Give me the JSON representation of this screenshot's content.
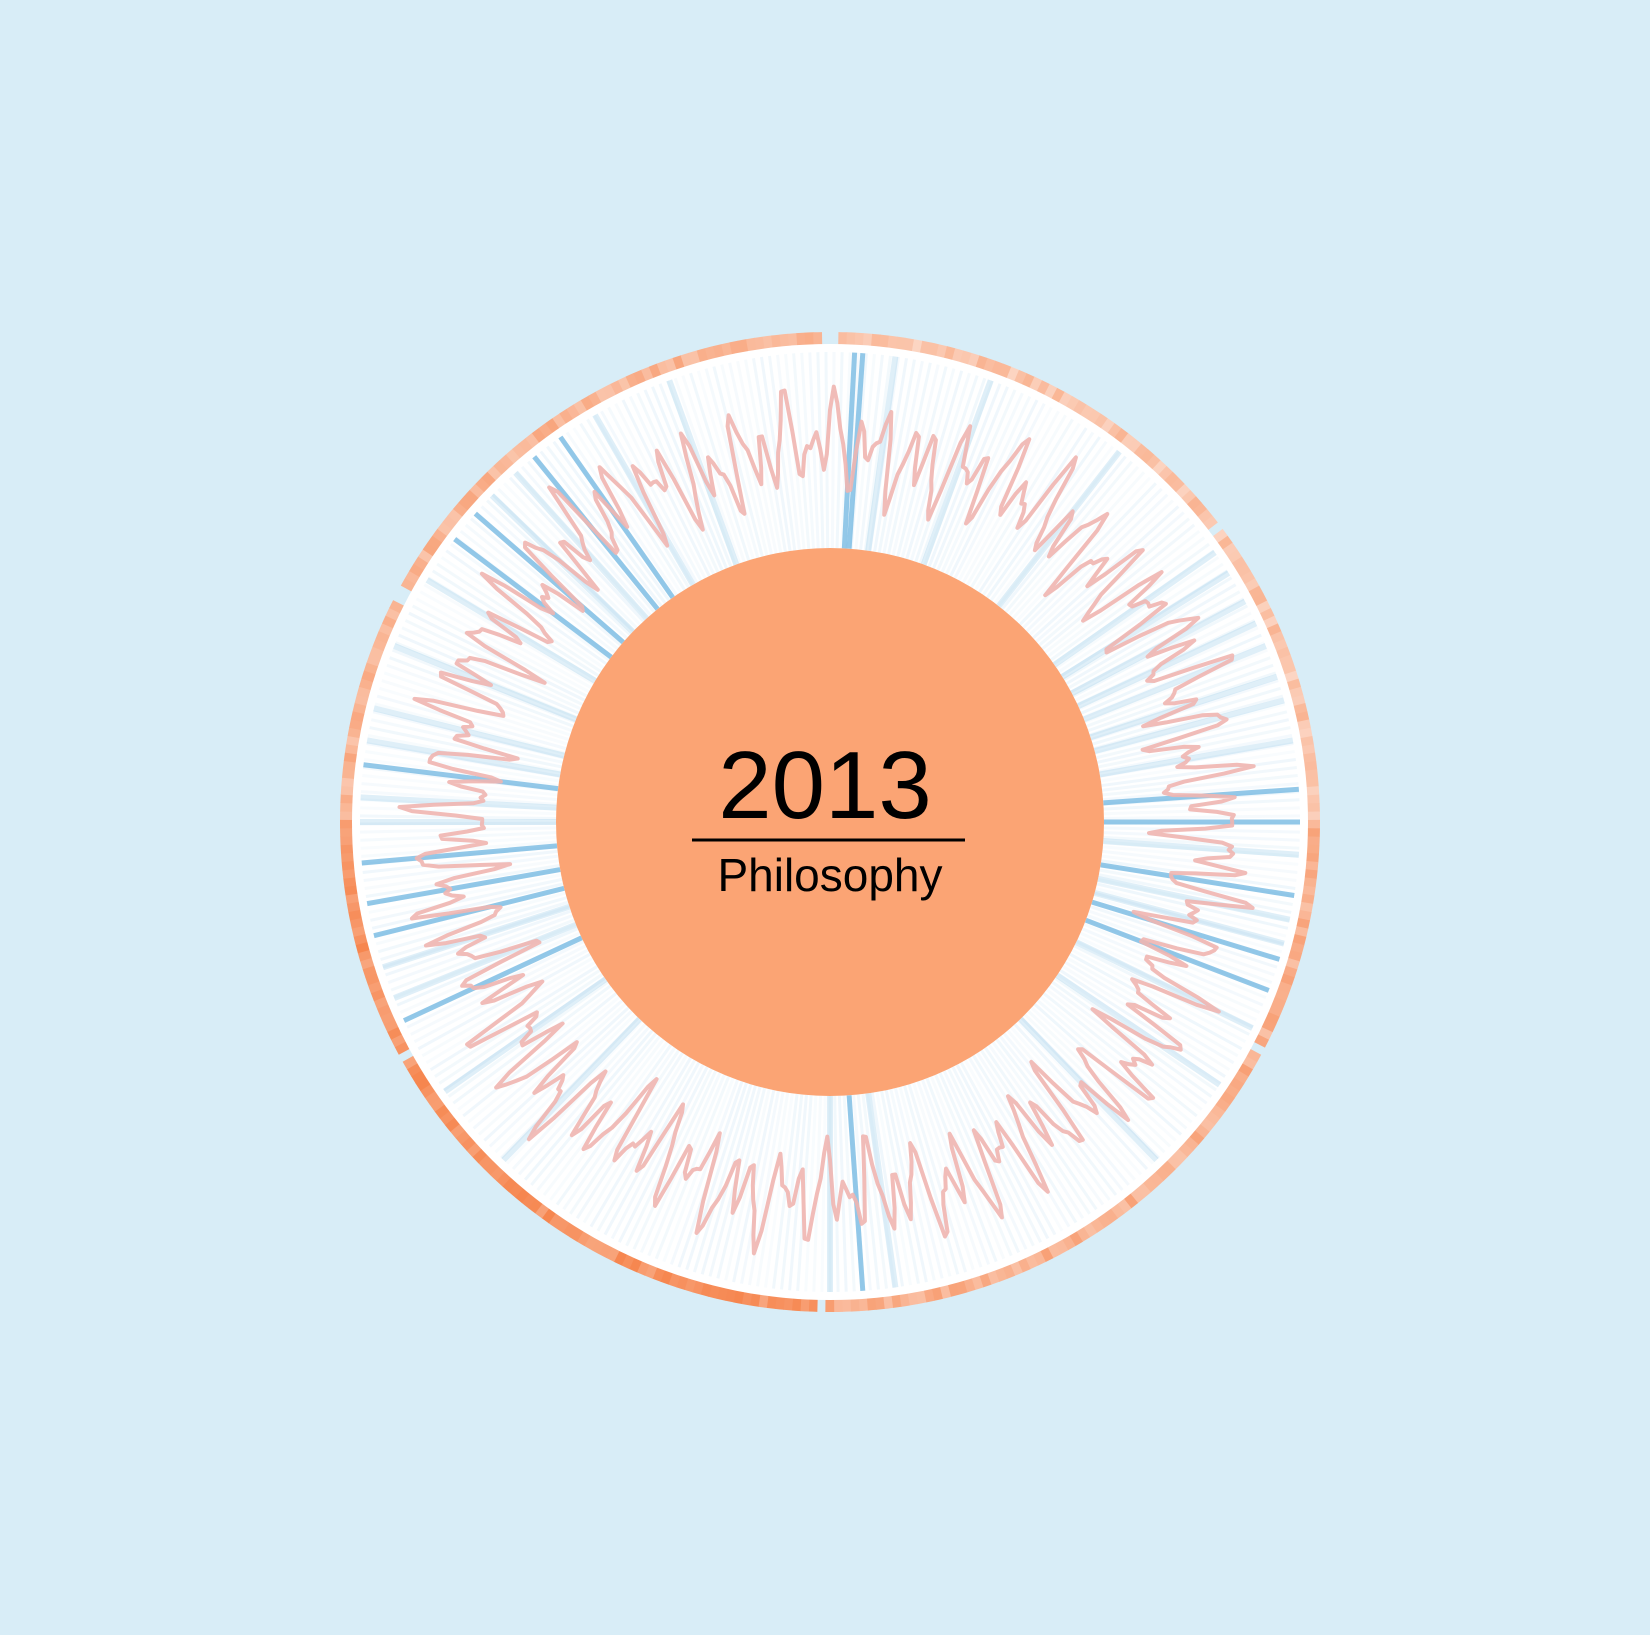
{
  "colors": {
    "background": "#d8edf7",
    "center_fill": "#fba474",
    "wave_stroke": "#f0b5b0",
    "ray_color": "#6fb5e0",
    "ring_light": "#fde6dc",
    "ring_dark": "#f6864f"
  },
  "center": {
    "year": "2013",
    "subject": "Philosophy"
  },
  "chart_data": {
    "type": "radial",
    "segments": 365,
    "outer_ring_gaps_deg": [
      0,
      53,
      118,
      181,
      241,
      298
    ],
    "highlight_rays_deg": [
      3,
      4,
      86,
      90,
      99,
      107,
      111,
      176,
      245,
      256,
      260,
      265,
      277,
      307,
      311,
      321,
      325
    ],
    "medium_rays_deg": [
      8,
      20,
      38,
      55,
      58,
      62,
      65,
      68,
      72,
      75,
      80,
      94,
      102,
      105,
      116,
      124,
      136,
      172,
      180,
      224,
      235,
      248,
      252,
      270,
      273,
      280,
      284,
      292,
      301,
      314,
      318,
      330,
      340
    ],
    "ring_intensity_by_quadrant": [
      0.35,
      0.55,
      0.85,
      0.5
    ]
  }
}
